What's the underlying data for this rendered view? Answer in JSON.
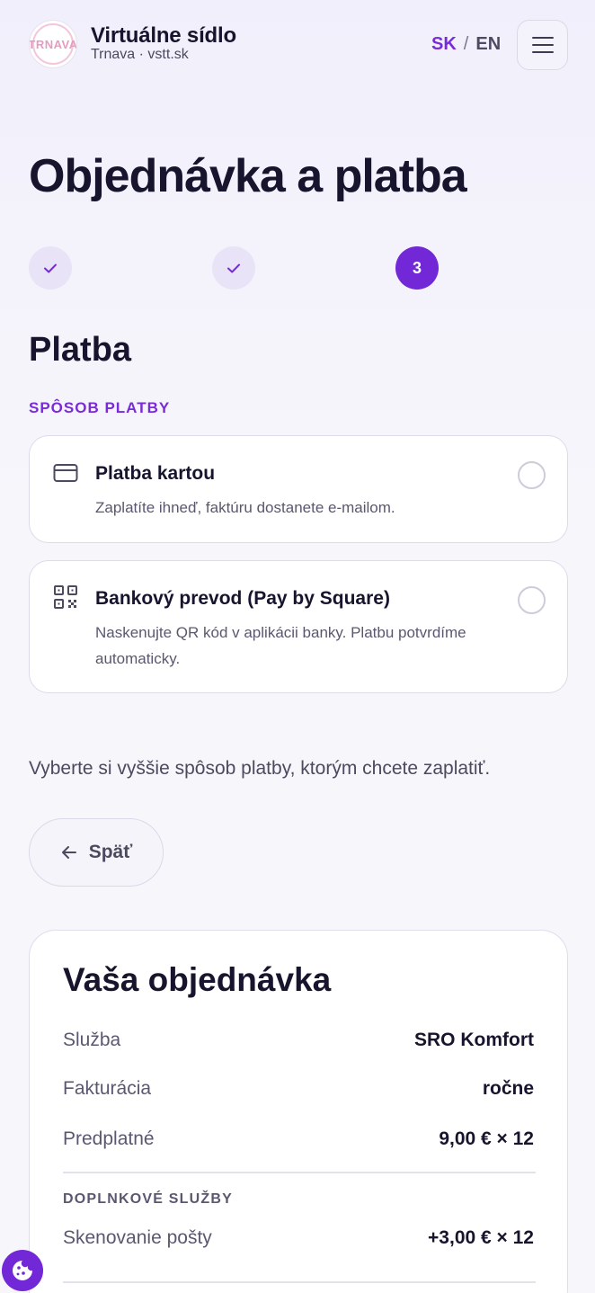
{
  "header": {
    "logo_text": "TRNAVA",
    "brand_title": "Virtuálne sídlo",
    "brand_sub": "Trnava · vstt.sk",
    "lang_active": "SK",
    "lang_sep": "/",
    "lang_other": "EN"
  },
  "page_title": "Objednávka a platba",
  "stepper": {
    "step3": "3"
  },
  "payment": {
    "section_title": "Platba",
    "section_label": "SPÔSOB PLATBY",
    "options": [
      {
        "icon": "credit-card-icon",
        "title": "Platba kartou",
        "desc": "Zaplatíte ihneď, faktúru dostanete e-mailom."
      },
      {
        "icon": "qr-code-icon",
        "title": "Bankový prevod (Pay by Square)",
        "desc": "Naskenujte QR kód v aplikácii banky. Platbu potvrdíme automaticky."
      }
    ],
    "hint": "Vyberte si vyššie spôsob platby, ktorým chcete zaplatiť.",
    "back_label": "Späť"
  },
  "summary": {
    "title": "Vaša objednávka",
    "rows": [
      {
        "label": "Služba",
        "value": "SRO Komfort"
      },
      {
        "label": "Fakturácia",
        "value": "ročne"
      },
      {
        "label": "Predplatné",
        "value": "9,00 € × 12"
      }
    ],
    "addons_label": "DOPLNKOVÉ SLUŽBY",
    "addons": [
      {
        "label": "Skenovanie pošty",
        "value": "+3,00 € × 12"
      }
    ]
  },
  "colors": {
    "accent": "#7228d6",
    "text": "#17152e",
    "muted": "#5a5870"
  }
}
